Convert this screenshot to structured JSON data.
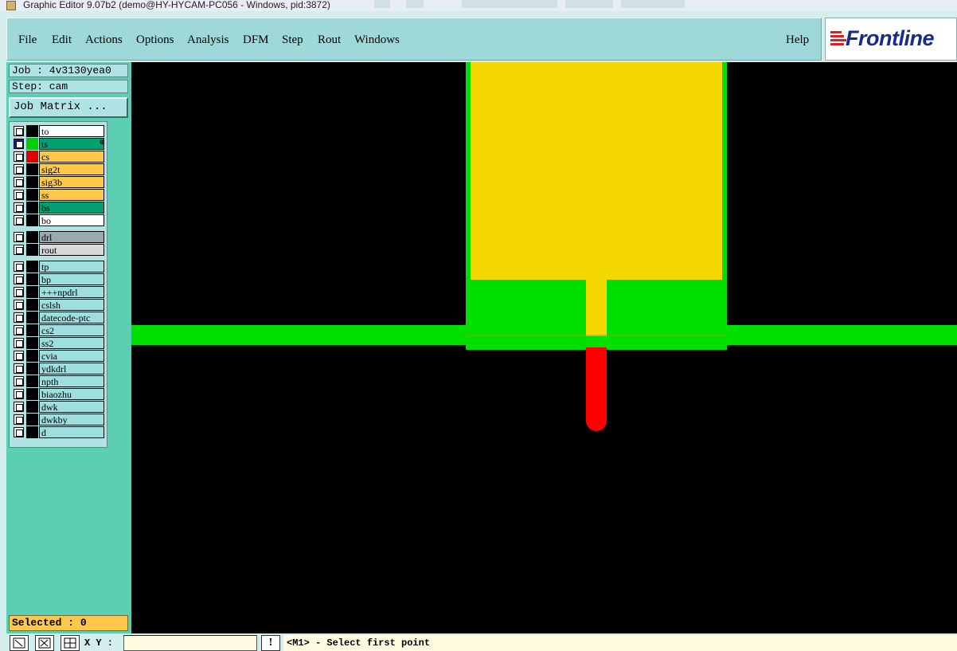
{
  "window": {
    "title": "Graphic Editor 9.07b2 (demo@HY-HYCAM-PC056 - Windows, pid:3872)"
  },
  "menu": {
    "items": [
      {
        "label": "File"
      },
      {
        "label": "Edit"
      },
      {
        "label": "Actions"
      },
      {
        "label": "Options"
      },
      {
        "label": "Analysis"
      },
      {
        "label": "DFM"
      },
      {
        "label": "Step"
      },
      {
        "label": "Rout"
      },
      {
        "label": "Windows"
      }
    ],
    "help": "Help"
  },
  "logo": {
    "text": "Frontline",
    "icon": "frontline-logo-icon"
  },
  "panel": {
    "job": "Job : 4v3130yea0",
    "step": "Step: cam",
    "job_matrix": "Job Matrix ...",
    "selected": "Selected : 0"
  },
  "layers": [
    {
      "name": "to",
      "bg": "#ffffff",
      "swatch": "#000000",
      "checked": false
    },
    {
      "name": "ts",
      "bg": "#00a070",
      "swatch": "#00d000",
      "checked": true,
      "mark": "⊕"
    },
    {
      "name": "cs",
      "bg": "#ffc84a",
      "swatch": "#e00000",
      "checked": false
    },
    {
      "name": "sig2t",
      "bg": "#ffc84a",
      "swatch": "#000000",
      "checked": false
    },
    {
      "name": "sig3b",
      "bg": "#ffc84a",
      "swatch": "#000000",
      "checked": false
    },
    {
      "name": "ss",
      "bg": "#ffc84a",
      "swatch": "#000000",
      "checked": false
    },
    {
      "name": "bs",
      "bg": "#00a070",
      "swatch": "#000000",
      "checked": false
    },
    {
      "name": "bo",
      "bg": "#ffffff",
      "swatch": "#000000",
      "checked": false
    },
    {
      "name": "drl",
      "bg": "#98aab0",
      "swatch": "#000000",
      "checked": false
    },
    {
      "name": "rout",
      "bg": "#d8d8d8",
      "swatch": "#000000",
      "checked": false
    },
    {
      "name": "tp",
      "bg": "#9edede",
      "swatch": "#000000",
      "checked": false
    },
    {
      "name": "bp",
      "bg": "#9edede",
      "swatch": "#000000",
      "checked": false
    },
    {
      "name": "+++npdrl",
      "bg": "#9edede",
      "swatch": "#000000",
      "checked": false
    },
    {
      "name": "cslsh",
      "bg": "#9edede",
      "swatch": "#000000",
      "checked": false
    },
    {
      "name": "datecode-ptc",
      "bg": "#9edede",
      "swatch": "#000000",
      "checked": false
    },
    {
      "name": "cs2",
      "bg": "#9edede",
      "swatch": "#000000",
      "checked": false
    },
    {
      "name": "ss2",
      "bg": "#9edede",
      "swatch": "#000000",
      "checked": false
    },
    {
      "name": "cvia",
      "bg": "#9edede",
      "swatch": "#000000",
      "checked": false
    },
    {
      "name": "ydkdrl",
      "bg": "#9edede",
      "swatch": "#000000",
      "checked": false
    },
    {
      "name": "npth",
      "bg": "#9edede",
      "swatch": "#000000",
      "checked": false
    },
    {
      "name": "biaozhu",
      "bg": "#9edede",
      "swatch": "#000000",
      "checked": false
    },
    {
      "name": "dwk",
      "bg": "#9edede",
      "swatch": "#000000",
      "checked": false
    },
    {
      "name": "dwkby",
      "bg": "#9edede",
      "swatch": "#000000",
      "checked": false
    },
    {
      "name": "d",
      "bg": "#9edede",
      "swatch": "#000000",
      "checked": false
    }
  ],
  "colors": {
    "solder_mask_green": "#00e000",
    "copper_yellow": "#f5d800",
    "paste_red": "#ff0000",
    "canvas_bg": "#000000"
  },
  "status": {
    "xy_label": "X Y :",
    "xy_value": "",
    "prompt": "<M1> - Select first point",
    "tools": [
      {
        "icon": "zoom-area-icon"
      },
      {
        "icon": "measure-icon"
      },
      {
        "icon": "snap-grid-icon"
      }
    ],
    "warn": "!"
  }
}
